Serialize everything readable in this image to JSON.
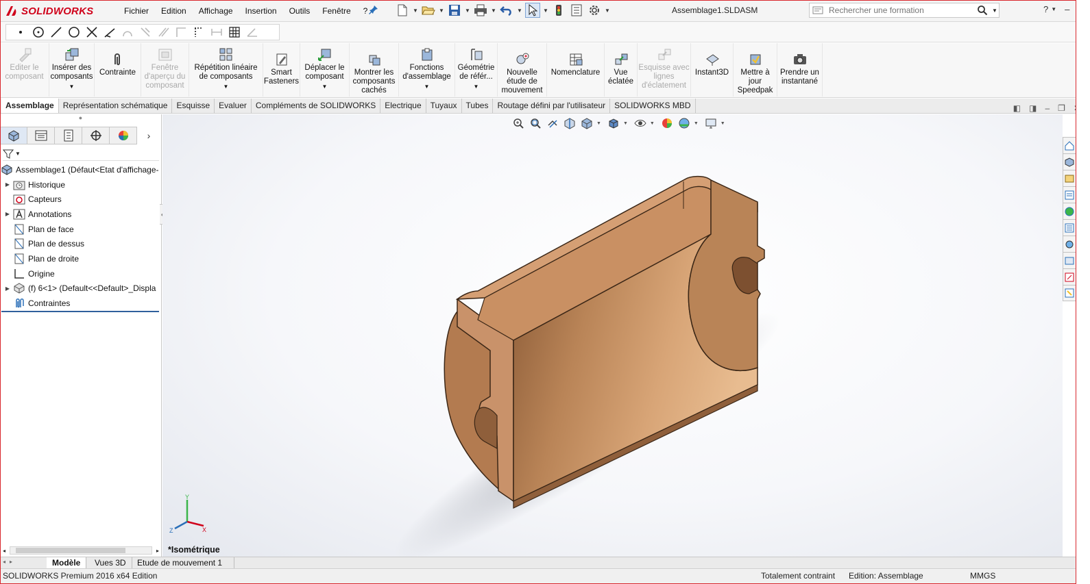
{
  "app": {
    "brand": "SOLIDWORKS",
    "document_title": "Assemblage1.SLDASM",
    "accent_color": "#d0021b"
  },
  "menu": [
    "Fichier",
    "Edition",
    "Affichage",
    "Insertion",
    "Outils",
    "Fenêtre",
    "?"
  ],
  "search": {
    "placeholder": "Rechercher une formation"
  },
  "window_controls": {
    "help": "?",
    "minimize": "–",
    "restore": "❐"
  },
  "command_manager": [
    {
      "label": "Editer le composant",
      "icon": "edit-component-icon",
      "disabled": true
    },
    {
      "label": "Insérer des composants",
      "icon": "insert-components-icon",
      "disabled": false,
      "dropdown": true
    },
    {
      "label": "Contrainte",
      "icon": "mate-paperclip-icon",
      "disabled": false
    },
    {
      "label": "Fenêtre d'aperçu du composant",
      "icon": "component-preview-icon",
      "disabled": true
    },
    {
      "label": "Répétition linéaire de composants",
      "icon": "linear-pattern-icon",
      "disabled": false,
      "dropdown": true
    },
    {
      "label": "Smart Fasteners",
      "icon": "smart-fasteners-icon",
      "disabled": false
    },
    {
      "label": "Déplacer le composant",
      "icon": "move-component-icon",
      "disabled": false,
      "dropdown": true
    },
    {
      "label": "Montrer les composants cachés",
      "icon": "show-hidden-icon",
      "disabled": false
    },
    {
      "label": "Fonctions d'assemblage",
      "icon": "assembly-features-icon",
      "disabled": false,
      "dropdown": true
    },
    {
      "label": "Géométrie de référ...",
      "icon": "reference-geometry-icon",
      "disabled": false,
      "dropdown": true
    },
    {
      "label": "Nouvelle étude de mouvement",
      "icon": "motion-study-icon",
      "disabled": false
    },
    {
      "label": "Nomenclature",
      "icon": "bom-icon",
      "disabled": false
    },
    {
      "label": "Vue éclatée",
      "icon": "exploded-view-icon",
      "disabled": false
    },
    {
      "label": "Esquisse avec lignes d'éclatement",
      "icon": "explode-line-icon",
      "disabled": true
    },
    {
      "label": "Instant3D",
      "icon": "instant3d-icon",
      "disabled": false
    },
    {
      "label": "Mettre à jour Speedpak",
      "icon": "speedpak-icon",
      "disabled": false
    },
    {
      "label": "Prendre un instantané",
      "icon": "snapshot-camera-icon",
      "disabled": false
    }
  ],
  "tabs": [
    "Assemblage",
    "Représentation schématique",
    "Esquisse",
    "Evaluer",
    "Compléments de SOLIDWORKS",
    "Electrique",
    "Tuyaux",
    "Tubes",
    "Routage défini par l'utilisateur",
    "SOLIDWORKS MBD"
  ],
  "active_tab": "Assemblage",
  "feature_tree": [
    {
      "label": "Assemblage1  (Défaut<Etat d'affichage-",
      "icon": "assembly-icon",
      "expander": ""
    },
    {
      "label": "Historique",
      "icon": "history-folder-icon",
      "expander": "▶"
    },
    {
      "label": "Capteurs",
      "icon": "sensor-icon",
      "expander": ""
    },
    {
      "label": "Annotations",
      "icon": "annotations-icon",
      "expander": "▶"
    },
    {
      "label": "Plan de face",
      "icon": "plane-icon",
      "expander": ""
    },
    {
      "label": "Plan de dessus",
      "icon": "plane-icon",
      "expander": ""
    },
    {
      "label": "Plan de droite",
      "icon": "plane-icon",
      "expander": ""
    },
    {
      "label": "Origine",
      "icon": "origin-icon",
      "expander": ""
    },
    {
      "label": "(f) 6<1> (Default<<Default>_Displa",
      "icon": "part-icon",
      "expander": "▶"
    },
    {
      "label": "Contraintes",
      "icon": "mates-icon",
      "expander": ""
    }
  ],
  "viewport": {
    "view_name": "*Isométrique",
    "part_color": "#c08a5c",
    "axis": {
      "x": "X",
      "y": "Y",
      "z": "Z"
    }
  },
  "bottom_tabs": [
    "Modèle",
    "Vues 3D",
    "Etude de mouvement 1"
  ],
  "active_bottom_tab": "Modèle",
  "status_bar": {
    "product": "SOLIDWORKS Premium 2016 x64 Edition",
    "constraint": "Totalement contraint",
    "mode": "Edition: Assemblage",
    "units": "MMGS"
  }
}
